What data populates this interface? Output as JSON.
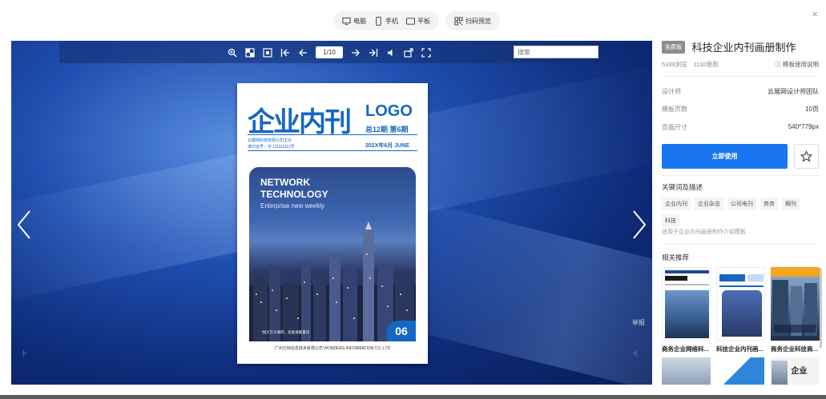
{
  "device_switcher": {
    "items": [
      {
        "label": "电脑",
        "icon": "desktop-icon"
      },
      {
        "label": "手机",
        "icon": "phone-icon"
      },
      {
        "label": "平板",
        "icon": "tablet-icon"
      }
    ],
    "scan_preview": {
      "label": "扫码预览",
      "icon": "qrcode-icon"
    }
  },
  "close": {
    "icon": "close-icon",
    "glyph": "×"
  },
  "viewer": {
    "page_indicator": "1/10",
    "search_placeholder": "搜索",
    "report_label": "举报",
    "first_glyph": "|‹",
    "last_glyph": "›|"
  },
  "magazine": {
    "title": "企业内刊",
    "logo": "LOGO",
    "issue": "总12期  第6期",
    "small_line1": "云展网科技有限公司主办",
    "small_line2": "准印证号：字 111111111号",
    "date": "202X年6月   JUNE",
    "headline_line1": "NETWORK",
    "headline_line2": "TECHNOLOGY",
    "headline_sub": "Enterprise new weekly",
    "issue_number": "06",
    "photo_caption": "\"如大方于闻所。双金海集量讯",
    "footer": "广州万际信息技术有限公司   WONDERS INFORMATION CO.,LTD"
  },
  "template": {
    "badge": "免费版",
    "title": "科技企业内刊画册制作",
    "views": "5339浏览",
    "uses": "1110使用",
    "help_link": "模板使用说明",
    "meta": [
      {
        "key": "设计师",
        "value": "云展网设计师团队"
      },
      {
        "key": "模板页数",
        "value": "10页"
      },
      {
        "key": "页面尺寸",
        "value": "540*779px"
      }
    ],
    "use_button": "立即使用",
    "keywords_title": "关键词及描述",
    "tags": [
      "企业内刊",
      "企业杂志",
      "公司电刊",
      "商务",
      "期刊",
      "科技"
    ],
    "description": "适用于企业内刊画册制作介绍模板",
    "related_title": "相关推荐",
    "related": [
      {
        "label": "商务企业网络科..."
      },
      {
        "label": "科技企业内刊画..."
      },
      {
        "label": "商务企业科技商..."
      }
    ],
    "related_thumb2_text": [
      "",
      "",
      "企业"
    ]
  },
  "colors": {
    "accent": "#1976f0",
    "magazine_blue": "#1567c4"
  }
}
